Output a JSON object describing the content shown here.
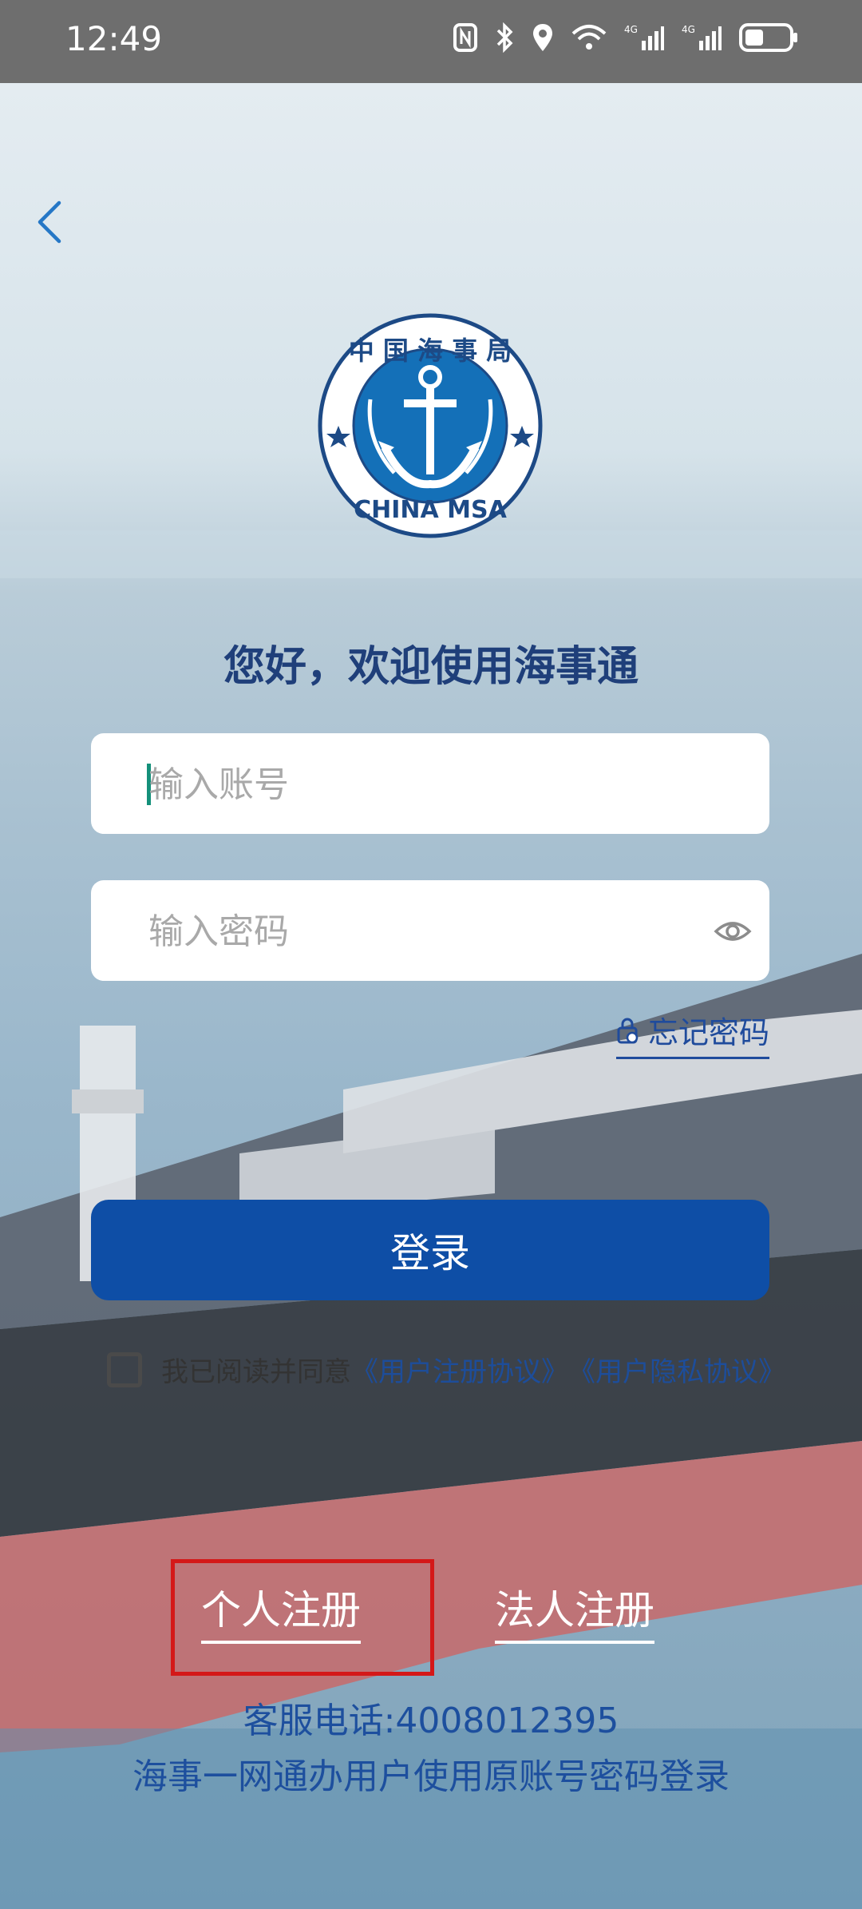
{
  "status_bar": {
    "time": "12:49",
    "icons": [
      "nfc-icon",
      "bluetooth-icon",
      "location-icon",
      "wifi-icon",
      "signal-4g-1-icon",
      "signal-4g-2-icon",
      "battery-icon"
    ]
  },
  "logo": {
    "top_text": "中国海事局",
    "bottom_text": "CHINA MSA",
    "color": "#1470b8"
  },
  "greeting": "您好，欢迎使用海事通",
  "account": {
    "placeholder": "输入账号",
    "value": ""
  },
  "password": {
    "placeholder": "输入密码",
    "value": ""
  },
  "forgot_password": "忘记密码",
  "login_button": "登录",
  "agreement": {
    "prefix": "我已阅读并同意",
    "terms": "《用户注册协议》",
    "privacy": "《用户隐私协议》"
  },
  "register": {
    "personal": "个人注册",
    "corporate": "法人注册"
  },
  "customer_service": "客服电话:4008012395",
  "legacy_login_note": "海事一网通办用户使用原账号密码登录",
  "colors": {
    "primary": "#0e4ea6",
    "link": "#1d4d9a",
    "highlight": "#d41818"
  }
}
